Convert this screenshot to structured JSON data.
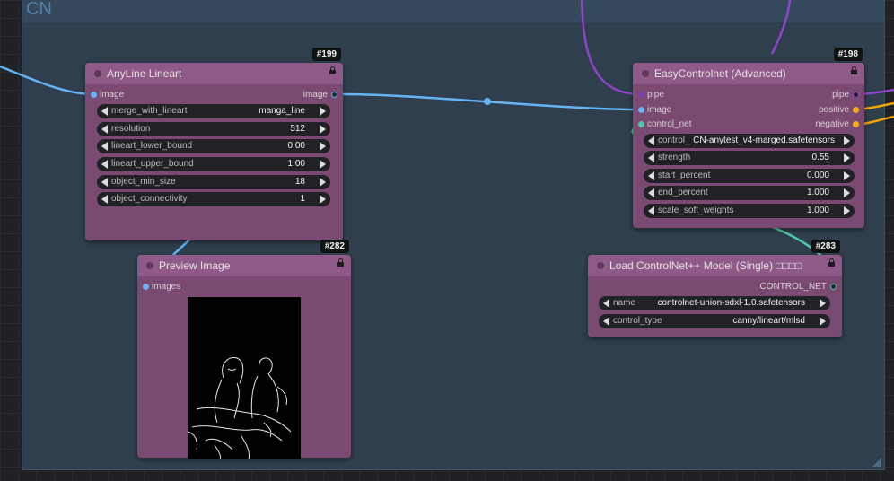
{
  "group": {
    "title": "CN"
  },
  "colors": {
    "node_body": "#7a4a72",
    "node_header": "#8f5a87",
    "group_bg": "#2f3f4d",
    "wire_image": "#64b5f6",
    "wire_pipe": "#8e44c8",
    "wire_conditioning": "#f0a500",
    "wire_control_net": "#4ec9a5"
  },
  "nodes": {
    "anyline": {
      "id": "#199",
      "title": "AnyLine Lineart",
      "input_image": "image",
      "output_image": "image",
      "widgets": [
        {
          "label": "merge_with_lineart",
          "value": "manga_line"
        },
        {
          "label": "resolution",
          "value": "512"
        },
        {
          "label": "lineart_lower_bound",
          "value": "0.00"
        },
        {
          "label": "lineart_upper_bound",
          "value": "1.00"
        },
        {
          "label": "object_min_size",
          "value": "18"
        },
        {
          "label": "object_connectivity",
          "value": "1"
        }
      ]
    },
    "easy_controlnet": {
      "id": "#198",
      "title": "EasyControlnet (Advanced)",
      "inputs": [
        "pipe",
        "image",
        "control_net"
      ],
      "outputs": [
        "pipe",
        "positive",
        "negative"
      ],
      "widgets": [
        {
          "label": "control_",
          "value": "CN-anytest_v4-marged.safetensors"
        },
        {
          "label": "strength",
          "value": "0.55"
        },
        {
          "label": "start_percent",
          "value": "0.000"
        },
        {
          "label": "end_percent",
          "value": "1.000"
        },
        {
          "label": "scale_soft_weights",
          "value": "1.000"
        }
      ]
    },
    "preview": {
      "id": "#282",
      "title": "Preview Image",
      "input_images": "images"
    },
    "load_controlnet": {
      "id": "#283",
      "title": "Load ControlNet++ Model (Single) □□□□",
      "output": "CONTROL_NET",
      "widgets": [
        {
          "label": "name",
          "value": "controlnet-union-sdxl-1.0.safetensors"
        },
        {
          "label": "control_type",
          "value": "canny/lineart/mlsd"
        }
      ]
    }
  }
}
